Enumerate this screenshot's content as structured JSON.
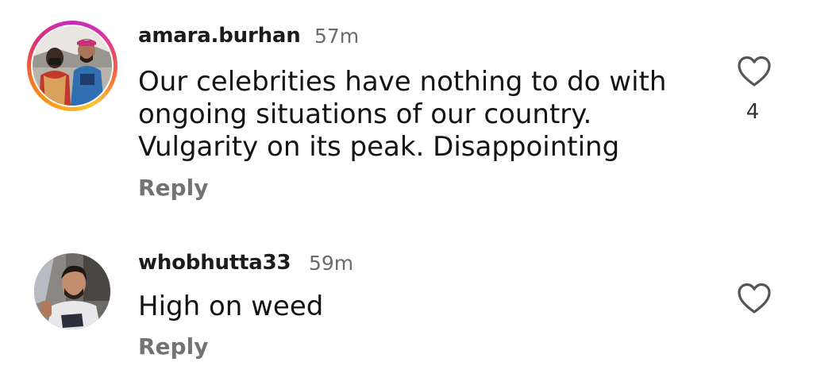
{
  "comments": [
    {
      "username": "amara.burhan",
      "timestamp": "57m",
      "lines": [
        "Our celebrities have nothing to do with",
        "ongoing situations of our country.",
        "Vulgarity on its peak. Disappointing"
      ],
      "reply_label": "Reply",
      "like_count": "4",
      "like_icon": "heart-outline-icon",
      "has_story_ring": true
    },
    {
      "username": "whobhutta33",
      "timestamp": "59m",
      "lines": [
        "High on weed"
      ],
      "reply_label": "Reply",
      "like_icon": "heart-outline-icon",
      "has_story_ring": false
    }
  ],
  "colors": {
    "username": "#1c1c1c",
    "timestamp": "#6b6b6b",
    "reply": "#737373",
    "icon": "#555555"
  }
}
